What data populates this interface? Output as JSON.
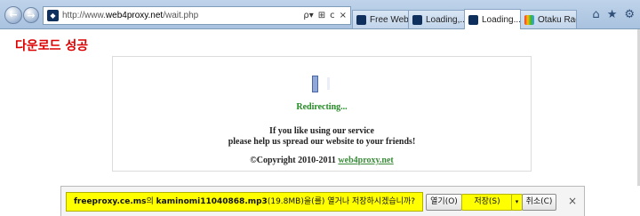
{
  "browser": {
    "address": {
      "prefix": "http://www.",
      "domain": "web4proxy.net",
      "path": "/wait.php",
      "tools": [
        "ρ▾",
        "⊞",
        "c",
        "×"
      ]
    },
    "tabs": [
      {
        "label": "Free Web ..."
      },
      {
        "label": "Loading,..."
      },
      {
        "label": "Loading...",
        "close": "×"
      },
      {
        "label": "Otaku Rad..."
      }
    ],
    "right_tools": {
      "home": "⌂",
      "favorites": "★",
      "settings": "⚙"
    }
  },
  "page": {
    "title": "다운로드 성공",
    "redirecting": "Redirecting...",
    "message_line1": "If you like using our service",
    "message_line2": "please help us spread our website to your friends!",
    "copyright": "©Copyright 2010-2011",
    "copyright_link": "web4proxy.net"
  },
  "download_bar": {
    "site": "freeproxy.ce.ms",
    "connector": "의",
    "filename": "kaminomi11040868.mp3",
    "size": "(19.8MB)",
    "question": "을(를) 열거나 저장하시겠습니까?",
    "open_label": "열기(O)",
    "save_label": "저장(S)",
    "save_dropdown": "▾",
    "cancel_label": "취소(C)",
    "close": "×"
  }
}
